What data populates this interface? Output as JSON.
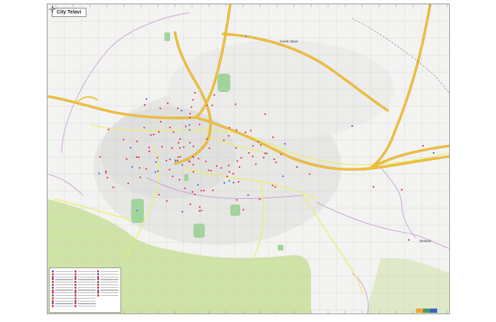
{
  "map": {
    "title": "City Telavi",
    "labels": {
      "north_district": "Kvireli Ubani",
      "east_district": "Shalauri"
    },
    "colors": {
      "land": "#f3f3f1",
      "forest": "#cfe3a6",
      "park": "#9fd49b",
      "major_road": "#f2c33a",
      "road_outline": "#d9a21c",
      "secondary_road": "#eeee66",
      "admin_boundary": "#c48bd3",
      "grid": "#cdcdcd",
      "poi_red": "#d5333a",
      "poi_blue": "#3c5fc7"
    },
    "icons": {
      "compass": "compass-rose-icon",
      "poi": "map-pin-icon"
    },
    "legend": {
      "has_entries": true
    }
  }
}
